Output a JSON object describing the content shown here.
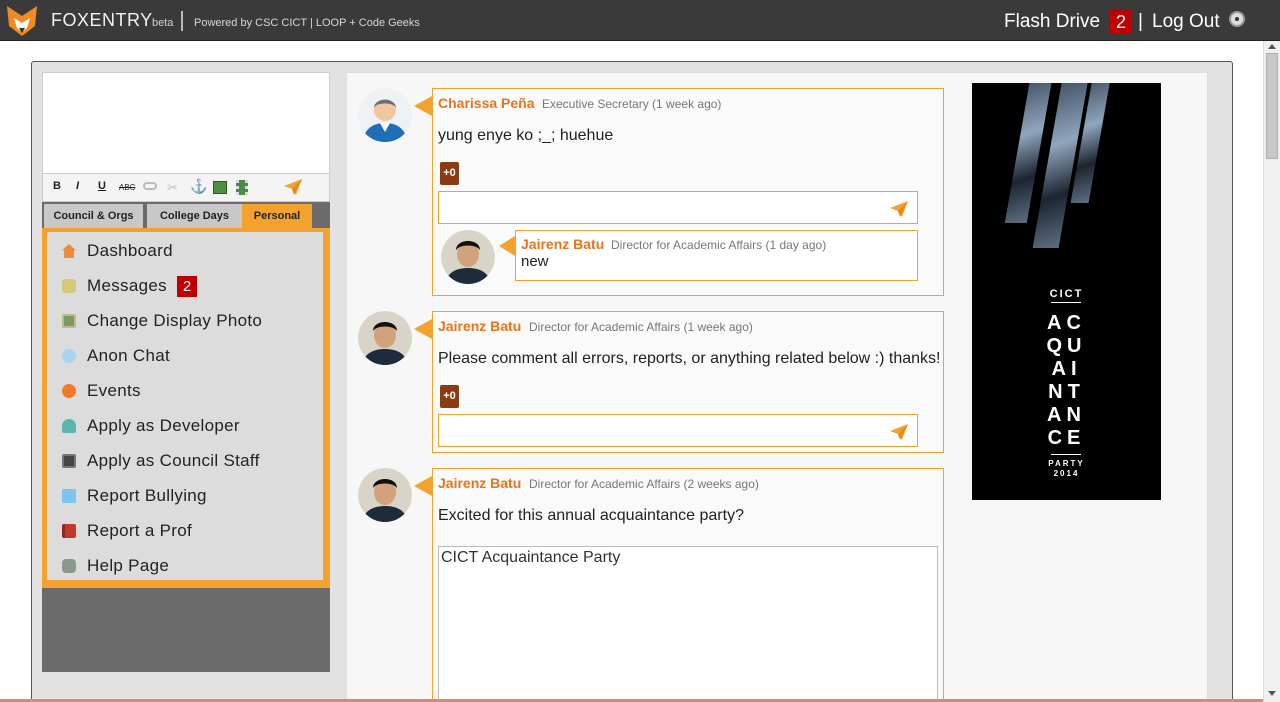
{
  "header": {
    "brand": "FOXENTRY",
    "beta": "beta",
    "powered": "Powered by CSC CICT | LOOP + Code Geeks",
    "flash_drive": "Flash Drive",
    "flash_count": "2",
    "pipe": "|",
    "logout": "Log Out"
  },
  "editor": {
    "toolbar": {
      "bold": "B",
      "italic": "I",
      "underline": "U",
      "strike": "ABC"
    }
  },
  "tabs": [
    {
      "label": "Council & Orgs"
    },
    {
      "label": "College Days"
    },
    {
      "label": "Personal"
    }
  ],
  "menu": {
    "items": [
      {
        "label": "Dashboard",
        "icon": "home-icon"
      },
      {
        "label": "Messages",
        "icon": "chat-icon"
      },
      {
        "label": "Change Display Photo",
        "icon": "photo-icon"
      },
      {
        "label": "Anon Chat",
        "icon": "anon-chat-icon"
      },
      {
        "label": "Events",
        "icon": "events-icon"
      },
      {
        "label": "Apply as Developer",
        "icon": "developer-icon"
      },
      {
        "label": "Apply as Council Staff",
        "icon": "council-icon"
      },
      {
        "label": "Report Bullying",
        "icon": "document-icon"
      },
      {
        "label": "Report a Prof",
        "icon": "book-icon"
      },
      {
        "label": "Help Page",
        "icon": "robot-icon"
      }
    ],
    "messages_badge": "2"
  },
  "posts": [
    {
      "name": "Charissa Peña",
      "role": "Executive Secretary (1 week ago)",
      "text": "yung enye ko ;_; huehue",
      "plus": "+0",
      "reply": {
        "name": "Jairenz Batu",
        "role": "Director for Academic Affairs (1 day ago)",
        "text": "new"
      }
    },
    {
      "name": "Jairenz Batu",
      "role": "Director for Academic Affairs (1 week ago)",
      "text": "Please comment all errors, reports, or anything related below :) thanks!",
      "plus": "+0"
    },
    {
      "name": "Jairenz Batu",
      "role": "Director for Academic Affairs (2 weeks ago)",
      "text": "Excited for this annual acquaintance party?",
      "attachment": "CICT Acquaintance Party"
    }
  ],
  "ad": {
    "org": "CICT",
    "lines": [
      "AC",
      "QU",
      "AI",
      "NT",
      "AN",
      "CE"
    ],
    "sub1": "PARTY",
    "sub2": "2014"
  },
  "colors": {
    "accent": "#f4a22d",
    "name": "#e8741c",
    "badge": "#c00000",
    "topbar": "#3a3a3a"
  }
}
